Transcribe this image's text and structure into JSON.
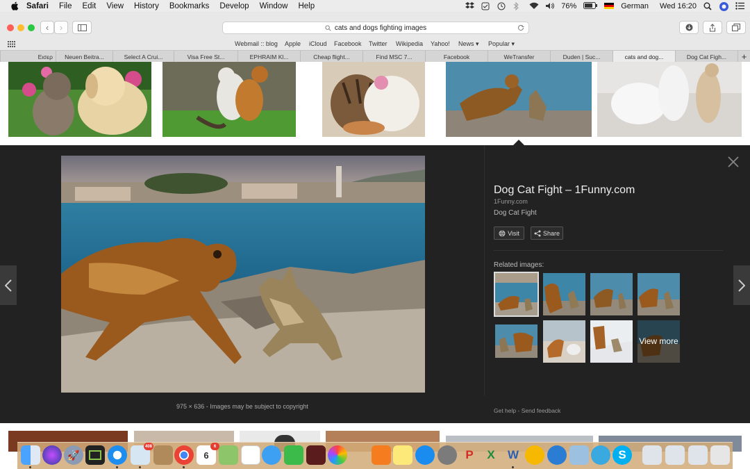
{
  "menubar": {
    "app": "Safari",
    "items": [
      "File",
      "Edit",
      "View",
      "History",
      "Bookmarks",
      "Develop",
      "Window",
      "Help"
    ],
    "battery": "76%",
    "input_source": "German",
    "clock": "Wed 16:20"
  },
  "browser": {
    "url": "cats and dogs fighting images",
    "favorites": [
      "Webmail :: blog",
      "Apple",
      "iCloud",
      "Facebook",
      "Twitter",
      "Wikipedia",
      "Yahoo!",
      "News ▾",
      "Popular ▾"
    ],
    "tabs": [
      "Εισερ",
      "Neuen Beitra...",
      "Select A Crui...",
      "Visa Free St...",
      "EPHRAIM Kl...",
      "Cheap flight...",
      "Find MSC 7...",
      "Facebook",
      "WeTransfer",
      "Duden | Suc...",
      "cats and dog...",
      "Dog Cat Figh..."
    ],
    "active_tab_index": 10
  },
  "preview": {
    "title": "Dog Cat Fight – 1Funny.com",
    "domain": "1Funny.com",
    "subtitle": "Dog Cat Fight",
    "visit_label": "Visit",
    "share_label": "Share",
    "related_label": "Related images:",
    "view_more_label": "View more",
    "image_size": "975 × 636",
    "copyright_note": "Images may be subject to copyright",
    "help_label": "Get help",
    "feedback_label": "Send feedback"
  },
  "dock": {
    "mail_badge": "408",
    "calendar_badge": "6",
    "calendar_day": "6"
  },
  "colors": {
    "panel_bg": "#222222",
    "menubar_bg": "#ececec",
    "close_red": "#ff5f57",
    "minimize_yellow": "#febc2e",
    "zoom_green": "#28c840"
  }
}
